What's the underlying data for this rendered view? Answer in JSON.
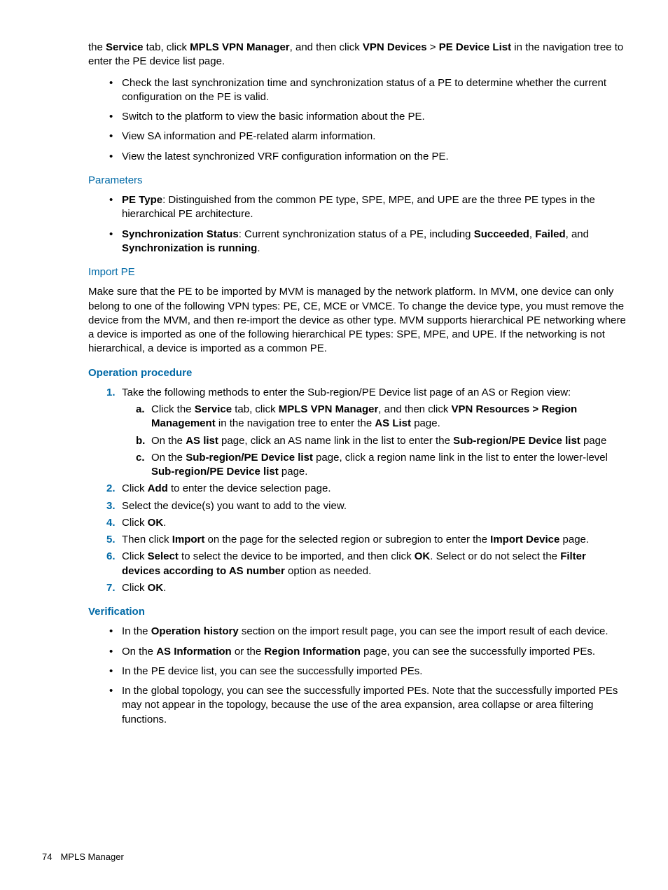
{
  "intro": {
    "pre": "the ",
    "service": "Service",
    "mid1": " tab, click ",
    "mpls": "MPLS VPN Manager",
    "mid2": ", and then click ",
    "vpnDevices": "VPN Devices",
    "gt": " > ",
    "peDeviceList": "PE Device List",
    "end": " in the navigation tree to enter the PE device list page."
  },
  "bullets1": [
    "Check the last synchronization time and synchronization status of a PE to determine whether the current configuration on the PE is valid.",
    "Switch to the platform to view the basic information about the PE.",
    "View SA information and PE-related alarm information.",
    "View the latest synchronized VRF configuration information on the PE."
  ],
  "headings": {
    "parameters": "Parameters",
    "importPE": "Import PE",
    "opProc": "Operation procedure",
    "verification": "Verification"
  },
  "params": {
    "peTypeLabel": "PE Type",
    "peTypeText": ": Distinguished from the common PE type, SPE, MPE, and UPE are the three PE types in the hierarchical PE architecture.",
    "syncLabel": "Synchronization Status",
    "syncText1": ": Current synchronization status of a PE, including ",
    "succeeded": "Succeeded",
    "failed": "Failed",
    "and": ", and ",
    "running": "Synchronization is running",
    "period": "."
  },
  "importPara": "Make sure that the PE to be imported by MVM is managed by the network platform. In MVM, one device can only belong to one of the following VPN types: PE, CE, MCE or VMCE. To change the device type, you must remove the device from the MVM, and then re-import the device as other type. MVM supports hierarchical PE networking where a device is imported as one of the following hierarchical PE types: SPE, MPE, and UPE. If the networking is not hierarchical, a device is imported as a common PE.",
  "op": {
    "step1Lead": "Take the following methods to enter the Sub-region/PE Device list page of an AS or Region view:",
    "a": {
      "t1": "Click the ",
      "service": "Service",
      "t2": " tab, click ",
      "mpls": "MPLS VPN Manager",
      "t3": ", and then click ",
      "vpnRes": "VPN Resources > Region Management",
      "t4": " in the navigation tree to enter the ",
      "aslist": "AS List",
      "t5": " page."
    },
    "b": {
      "t1": "On the ",
      "aslist": "AS list",
      "t2": " page, click an AS name link in the list to enter the ",
      "sub": "Sub-region/PE Device list",
      "t3": " page"
    },
    "c": {
      "t1": "On the ",
      "sub": "Sub-region/PE Device list",
      "t2": " page, click a region name link in the list to enter the lower-level ",
      "sub2": "Sub-region/PE Device list",
      "t3": " page."
    },
    "step2": {
      "t1": "Click ",
      "add": "Add",
      "t2": " to enter the device selection page."
    },
    "step3": "Select the device(s) you want to add to the view.",
    "step4": {
      "t1": "Click ",
      "ok": "OK",
      "t2": "."
    },
    "step5": {
      "t1": "Then click ",
      "imp": "Import",
      "t2": " on the page for the selected region or subregion to enter the ",
      "impDev": "Import Device",
      "t3": " page."
    },
    "step6": {
      "t1": "Click ",
      "sel": "Select",
      "t2": " to select the device to be imported, and then click ",
      "ok": "OK",
      "t3": ". Select or do not select the ",
      "filter": "Filter devices according to AS number",
      "t4": " option as needed."
    },
    "step7": {
      "t1": "Click ",
      "ok": "OK",
      "t2": "."
    }
  },
  "verify": {
    "v1": {
      "t1": "In the ",
      "b": "Operation history",
      "t2": " section on the import result page, you can see the import result of each device."
    },
    "v2": {
      "t1": "On the ",
      "b1": "AS Information",
      "t2": " or the ",
      "b2": "Region Information",
      "t3": " page, you can see the successfully imported PEs."
    },
    "v3": "In the PE device list, you can see the successfully imported PEs.",
    "v4": "In the global topology, you can see the successfully imported PEs. Note that the successfully imported PEs may not appear in the topology, because the use of the area expansion, area collapse or area filtering functions."
  },
  "footer": {
    "page": "74",
    "section": "MPLS Manager"
  }
}
